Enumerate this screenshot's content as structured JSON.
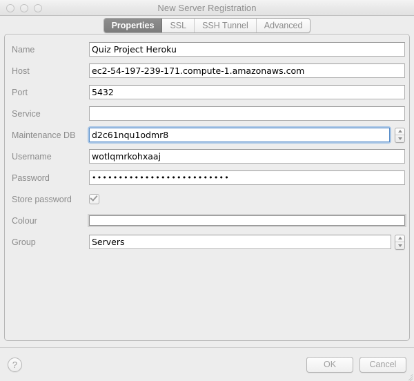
{
  "window": {
    "title": "New Server Registration",
    "traffic_lights": [
      "close-button",
      "minimize-button",
      "zoom-button"
    ]
  },
  "tabs": [
    {
      "label": "Properties",
      "selected": true
    },
    {
      "label": "SSL",
      "selected": false
    },
    {
      "label": "SSH Tunnel",
      "selected": false
    },
    {
      "label": "Advanced",
      "selected": false
    }
  ],
  "form": {
    "name": {
      "label": "Name",
      "value": "Quiz Project Heroku"
    },
    "host": {
      "label": "Host",
      "value": "ec2-54-197-239-171.compute-1.amazonaws.com"
    },
    "port": {
      "label": "Port",
      "value": "5432"
    },
    "service": {
      "label": "Service",
      "value": ""
    },
    "maintenance_db": {
      "label": "Maintenance DB",
      "value": "d2c61nqu1odmr8",
      "focused": true
    },
    "username": {
      "label": "Username",
      "value": "wotlqmrkohxaaj"
    },
    "password": {
      "label": "Password",
      "value": "••••••••••••••••••••••••••"
    },
    "store_password": {
      "label": "Store password",
      "checked": true
    },
    "colour": {
      "label": "Colour",
      "value": ""
    },
    "group": {
      "label": "Group",
      "value": "Servers"
    }
  },
  "buttons": {
    "help": "?",
    "ok": "OK",
    "cancel": "Cancel"
  },
  "colors": {
    "window_bg": "#ededed",
    "field_bg": "#ffffff",
    "label_text": "#8b8b8b",
    "value_text": "#000000",
    "focus_ring": "#6ca2de",
    "tab_selected_bg": "#858585"
  }
}
